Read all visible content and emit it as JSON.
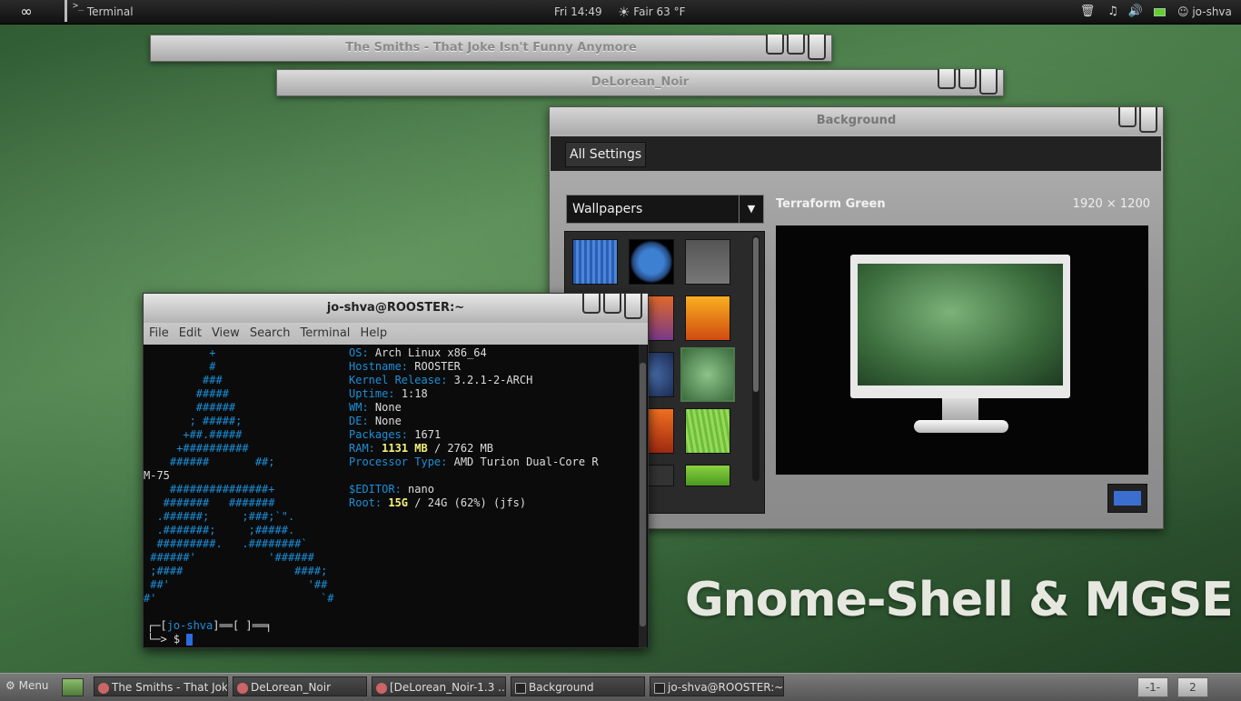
{
  "top_panel": {
    "activities_glyph": "∞",
    "app_menu_label": "Terminal",
    "app_menu_glyph": ">_",
    "clock": "Fri 14:49",
    "weather": "Fair 63 °F",
    "weather_icon": "☀",
    "trash_icon": "🗑",
    "music_icon": "♫",
    "volume_icon": "🔊",
    "user_label": "jo-shva",
    "user_icon": "☺"
  },
  "windows": {
    "smiths_title": "The Smiths - That Joke Isn't Funny Anymore",
    "delorean_title": "DeLorean_Noir"
  },
  "background_window": {
    "title": "Background",
    "all_settings": "All Settings",
    "dropdown_value": "Wallpapers",
    "dropdown_arrow": "▼",
    "add_glyph": "+",
    "selected_name": "Terraform Green",
    "selected_resolution": "1920 × 1200",
    "accent_color": "#3a6fd0"
  },
  "terminal": {
    "title": "jo-shva@ROOSTER:~",
    "menu": [
      "File",
      "Edit",
      "View",
      "Search",
      "Terminal",
      "Help"
    ],
    "logo_lines": [
      "          +",
      "          #",
      "         ###",
      "        #####",
      "        ######",
      "       ; #####;",
      "      +##.#####",
      "     +##########",
      "    ######       ##;",
      "M-75",
      "    ###############+",
      "   #######   #######",
      "  .######;     ;###;`\".",
      "  .#######;     ;#####.",
      "  #########.   .########`",
      " ######'           '######",
      " ;####                 ####;",
      " ##'                     '##",
      "#'                         `#"
    ],
    "info": {
      "os_key": "OS:",
      "os_val": "Arch Linux x86_64",
      "host_key": "Hostname:",
      "host_val": "ROOSTER",
      "kernel_key": "Kernel Release:",
      "kernel_val": "3.2.1-2-ARCH",
      "uptime_key": "Uptime:",
      "uptime_val": "1:18",
      "wm_key": "WM:",
      "wm_val": "None",
      "de_key": "DE:",
      "de_val": "None",
      "pkg_key": "Packages:",
      "pkg_val": "1671",
      "ram_key": "RAM:",
      "ram_used": "1131 MB",
      "ram_rest": "/ 2762 MB",
      "cpu_key": "Processor Type:",
      "cpu_val": "AMD Turion Dual-Core R",
      "editor_key": "$EDITOR:",
      "editor_val": "nano",
      "root_key": "Root:",
      "root_used": "15G",
      "root_rest": "/ 24G (62%) (jfs)"
    },
    "prompt_line1_a": "┌─[",
    "prompt_user": "jo-shva",
    "prompt_line1_b": "]══[ ]══╕",
    "prompt_line2": "└─> $"
  },
  "watermark": "Gnome-Shell & MGSE",
  "bottom_panel": {
    "menu_label": "Menu",
    "menu_icon": "⚙",
    "tasks": [
      "The Smiths - That Jok...",
      "DeLorean_Noir",
      "[DeLorean_Noir-1.3 ...",
      "Background",
      "jo-shva@ROOSTER:~"
    ],
    "workspaces": [
      "-1-",
      "2"
    ]
  }
}
